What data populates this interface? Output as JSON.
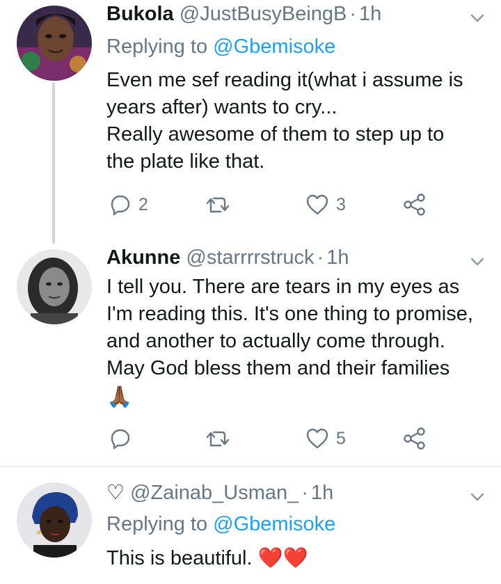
{
  "tweets": [
    {
      "name": "Bukola",
      "handle": "@JustBusyBeingB",
      "separator": "·",
      "time": "1h",
      "replying_prefix": "Replying to",
      "replying_to": "@Gbemisoke",
      "lines": [
        "Even me sef reading it(what i assume is",
        "years after) wants to cry...",
        "Really awesome of them to step up to",
        "the plate like that."
      ],
      "reply_count": "2",
      "retweet_count": "",
      "like_count": "3"
    },
    {
      "name": "Akunne",
      "handle": "@starrrrstruck",
      "separator": "·",
      "time": "1h",
      "lines": [
        "I tell you. There are tears in my eyes as",
        "I'm reading this. It's one thing to promise,",
        "and another to actually come through.",
        "May God bless them and their families"
      ],
      "emoji_line": "🙏🏾",
      "reply_count": "",
      "retweet_count": "",
      "like_count": "5"
    },
    {
      "name_symbol": "♡",
      "handle": "@Zainab_Usman_",
      "separator": "·",
      "time": "1h",
      "replying_prefix": "Replying to",
      "replying_to": "@Gbemisoke",
      "lines": [
        "This is beautiful. ❤️❤️"
      ]
    }
  ],
  "icons": {
    "reply": "reply-icon",
    "retweet": "retweet-icon",
    "like": "heart-icon",
    "share": "share-icon",
    "more": "chevron-down-icon"
  },
  "colors": {
    "text": "#14171a",
    "secondary": "#657786",
    "link": "#1da1f2",
    "thread_line": "#cdd7de",
    "divider": "#dfe4e8"
  }
}
